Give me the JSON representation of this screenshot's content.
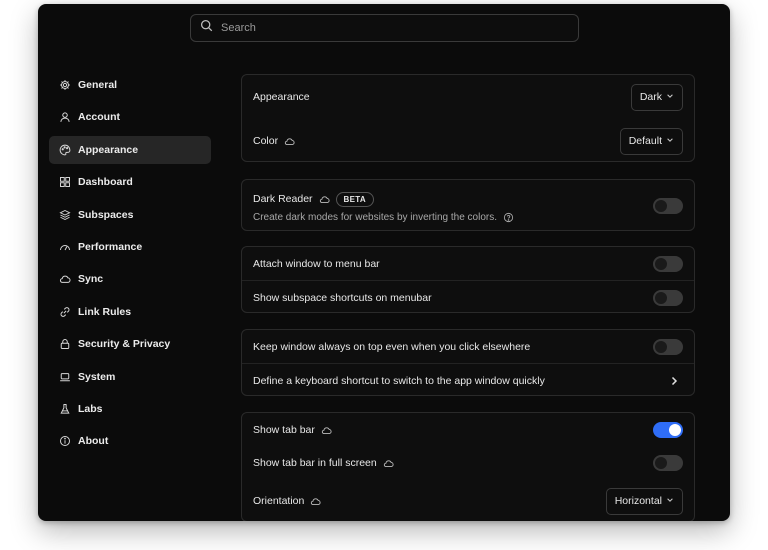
{
  "search": {
    "placeholder": "Search"
  },
  "sidebar": {
    "items": [
      {
        "label": "General",
        "icon": "gear-icon"
      },
      {
        "label": "Account",
        "icon": "user-icon"
      },
      {
        "label": "Appearance",
        "icon": "palette-icon",
        "active": true
      },
      {
        "label": "Dashboard",
        "icon": "dashboard-icon"
      },
      {
        "label": "Subspaces",
        "icon": "layers-icon"
      },
      {
        "label": "Performance",
        "icon": "gauge-icon"
      },
      {
        "label": "Sync",
        "icon": "cloud-icon"
      },
      {
        "label": "Link Rules",
        "icon": "link-icon"
      },
      {
        "label": "Security & Privacy",
        "icon": "lock-icon"
      },
      {
        "label": "System",
        "icon": "laptop-icon"
      },
      {
        "label": "Labs",
        "icon": "flask-icon"
      },
      {
        "label": "About",
        "icon": "info-icon"
      }
    ]
  },
  "appearance": {
    "theme_label": "Appearance",
    "theme_value": "Dark",
    "color_label": "Color",
    "color_value": "Default"
  },
  "dark_reader": {
    "label": "Dark Reader",
    "badge": "BETA",
    "description": "Create dark modes for websites by inverting the colors.",
    "enabled": false
  },
  "menubar": {
    "attach_label": "Attach window to menu bar",
    "attach_enabled": false,
    "shortcuts_label": "Show subspace shortcuts on menubar",
    "shortcuts_enabled": false
  },
  "window": {
    "on_top_label": "Keep window always on top even when you click elsewhere",
    "on_top_enabled": false,
    "keyboard_label": "Define a keyboard shortcut to switch to the app window quickly"
  },
  "tabbar": {
    "show_label": "Show tab bar",
    "show_enabled": true,
    "fullscreen_label": "Show tab bar in full screen",
    "fullscreen_enabled": false,
    "orientation_label": "Orientation",
    "orientation_value": "Horizontal"
  },
  "colors": {
    "accent": "#2f6df6",
    "background": "#0b0b0b",
    "active_nav": "#262626"
  }
}
